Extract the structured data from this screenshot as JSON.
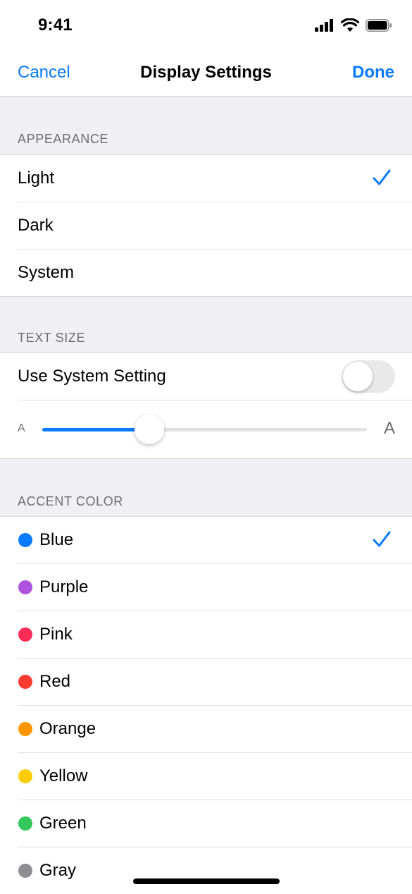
{
  "status": {
    "time": "9:41"
  },
  "nav": {
    "cancel": "Cancel",
    "title": "Display Settings",
    "done": "Done",
    "accent_color": "#0a7aff"
  },
  "appearance": {
    "header": "APPEARANCE",
    "options": [
      {
        "label": "Light",
        "selected": true
      },
      {
        "label": "Dark",
        "selected": false
      },
      {
        "label": "System",
        "selected": false
      }
    ]
  },
  "text_size": {
    "header": "TEXT SIZE",
    "use_system_label": "Use System Setting",
    "use_system_on": false,
    "small_a": "A",
    "large_a": "A",
    "slider_value": 0.33
  },
  "accent": {
    "header": "ACCENT COLOR",
    "colors": [
      {
        "label": "Blue",
        "hex": "#0a7aff",
        "selected": true
      },
      {
        "label": "Purple",
        "hex": "#af52de",
        "selected": false
      },
      {
        "label": "Pink",
        "hex": "#ff2d55",
        "selected": false
      },
      {
        "label": "Red",
        "hex": "#ff3b30",
        "selected": false
      },
      {
        "label": "Orange",
        "hex": "#ff9500",
        "selected": false
      },
      {
        "label": "Yellow",
        "hex": "#ffcc00",
        "selected": false
      },
      {
        "label": "Green",
        "hex": "#34c759",
        "selected": false
      },
      {
        "label": "Gray",
        "hex": "#8e8e93",
        "selected": false
      }
    ]
  }
}
